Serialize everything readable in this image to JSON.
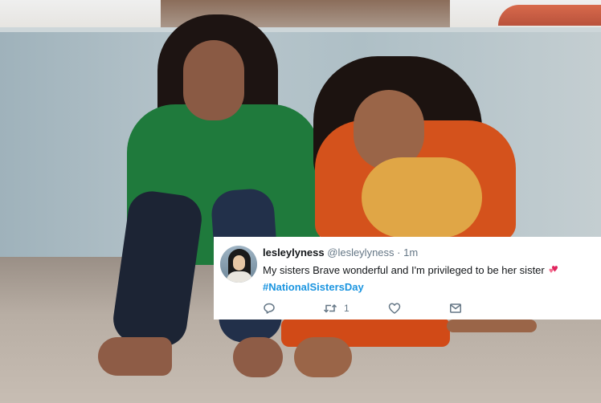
{
  "tweet": {
    "display_name": "lesleylyness",
    "handle": "@lesleylyness",
    "separator": "·",
    "time": "1m",
    "text": "My sisters Brave wonderful and I'm privileged to be her sister",
    "hashtag": "#NationalSistersDay",
    "emoji": "revolving-hearts",
    "retweet_count": "1",
    "colors": {
      "hashtag": "#1b95e0",
      "name": "#14171a",
      "meta": "#657786",
      "heart_emoji": "#e0245e"
    },
    "icons": [
      "reply-icon",
      "retweet-icon",
      "like-icon",
      "direct-message-icon"
    ]
  }
}
